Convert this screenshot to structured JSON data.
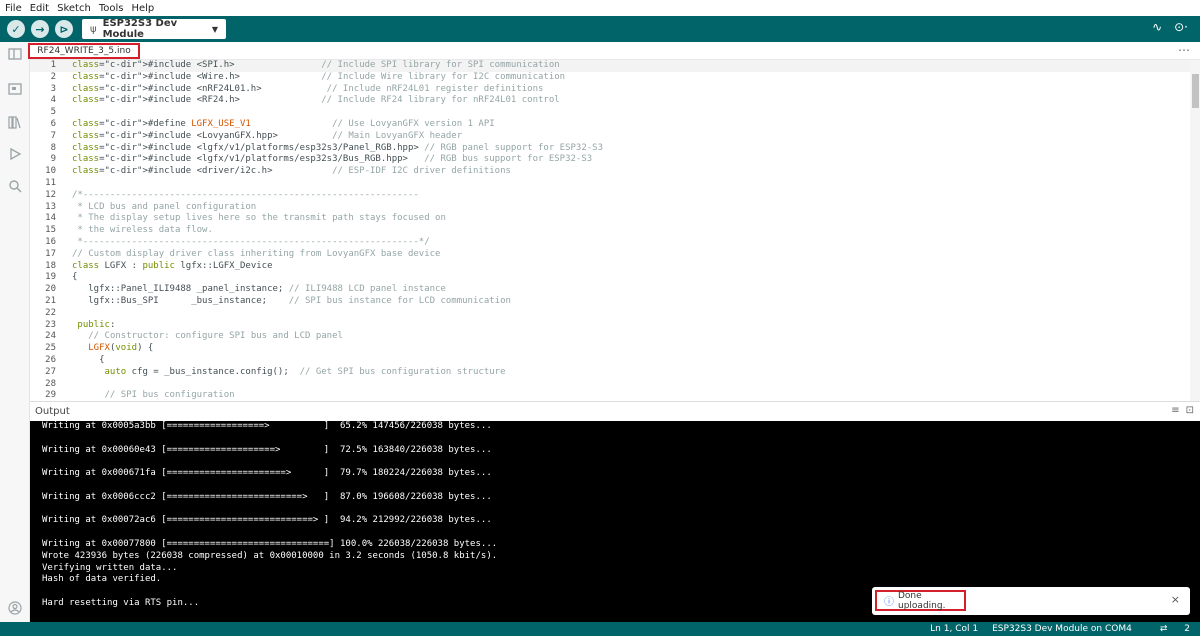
{
  "menu": [
    "File",
    "Edit",
    "Sketch",
    "Tools",
    "Help"
  ],
  "toolbar": {
    "verify_icon": "check-icon",
    "upload_icon": "arrow-right-icon",
    "debug_icon": "debug-icon",
    "board": "ESP32S3 Dev Module",
    "serial_plotter_icon": "pulse-icon",
    "serial_monitor_icon": "search-icon"
  },
  "tab": {
    "filename": "RF24_WRITE_3_5.ino",
    "more": "⋯"
  },
  "editor": {
    "lines": [
      {
        "n": "1",
        "t": "#include <SPI.h>                // Include SPI library for SPI communication"
      },
      {
        "n": "2",
        "t": "#include <Wire.h>               // Include Wire library for I2C communication"
      },
      {
        "n": "3",
        "t": "#include <nRF24L01.h>            // Include nRF24L01 register definitions"
      },
      {
        "n": "4",
        "t": "#include <RF24.h>               // Include RF24 library for nRF24L01 control"
      },
      {
        "n": "5",
        "t": ""
      },
      {
        "n": "6",
        "t": "#define LGFX_USE_V1               // Use LovyanGFX version 1 API"
      },
      {
        "n": "7",
        "t": "#include <LovyanGFX.hpp>          // Main LovyanGFX header"
      },
      {
        "n": "8",
        "t": "#include <lgfx/v1/platforms/esp32s3/Panel_RGB.hpp> // RGB panel support for ESP32-S3"
      },
      {
        "n": "9",
        "t": "#include <lgfx/v1/platforms/esp32s3/Bus_RGB.hpp>   // RGB bus support for ESP32-S3"
      },
      {
        "n": "10",
        "t": "#include <driver/i2c.h>           // ESP-IDF I2C driver definitions"
      },
      {
        "n": "11",
        "t": ""
      },
      {
        "n": "12",
        "t": "/*--------------------------------------------------------------"
      },
      {
        "n": "13",
        "t": " * LCD bus and panel configuration"
      },
      {
        "n": "14",
        "t": " * The display setup lives here so the transmit path stays focused on"
      },
      {
        "n": "15",
        "t": " * the wireless data flow."
      },
      {
        "n": "16",
        "t": " *--------------------------------------------------------------*/"
      },
      {
        "n": "17",
        "t": "// Custom display driver class inheriting from LovyanGFX base device"
      },
      {
        "n": "18",
        "t": "class LGFX : public lgfx::LGFX_Device"
      },
      {
        "n": "19",
        "t": "{"
      },
      {
        "n": "20",
        "t": "   lgfx::Panel_ILI9488 _panel_instance; // ILI9488 LCD panel instance"
      },
      {
        "n": "21",
        "t": "   lgfx::Bus_SPI      _bus_instance;    // SPI bus instance for LCD communication"
      },
      {
        "n": "22",
        "t": ""
      },
      {
        "n": "23",
        "t": " public:"
      },
      {
        "n": "24",
        "t": "   // Constructor: configure SPI bus and LCD panel"
      },
      {
        "n": "25",
        "t": "   LGFX(void) {"
      },
      {
        "n": "26",
        "t": "     {"
      },
      {
        "n": "27",
        "t": "      auto cfg = _bus_instance.config();  // Get SPI bus configuration structure"
      },
      {
        "n": "28",
        "t": ""
      },
      {
        "n": "29",
        "t": "      // SPI bus configuration"
      }
    ]
  },
  "output": {
    "title": "Output",
    "lines": [
      "Writing at 0x0005a3bb [==================>          ]  65.2% 147456/226038 bytes...",
      "",
      "Writing at 0x00060e43 [====================>        ]  72.5% 163840/226038 bytes...",
      "",
      "Writing at 0x000671fa [======================>      ]  79.7% 180224/226038 bytes...",
      "",
      "Writing at 0x0006ccc2 [=========================>   ]  87.0% 196608/226038 bytes...",
      "",
      "Writing at 0x00072ac6 [===========================> ]  94.2% 212992/226038 bytes...",
      "",
      "Writing at 0x00077800 [==============================] 100.0% 226038/226038 bytes...",
      "Wrote 423936 bytes (226038 compressed) at 0x00010000 in 3.2 seconds (1050.8 kbit/s).",
      "Verifying written data...",
      "Hash of data verified.",
      "",
      "Hard resetting via RTS pin..."
    ]
  },
  "toast": {
    "message": "Done uploading.",
    "close": "×"
  },
  "status": {
    "cursor": "Ln 1, Col 1",
    "board_port": "ESP32S3 Dev Module on COM4",
    "notifications": "2"
  }
}
